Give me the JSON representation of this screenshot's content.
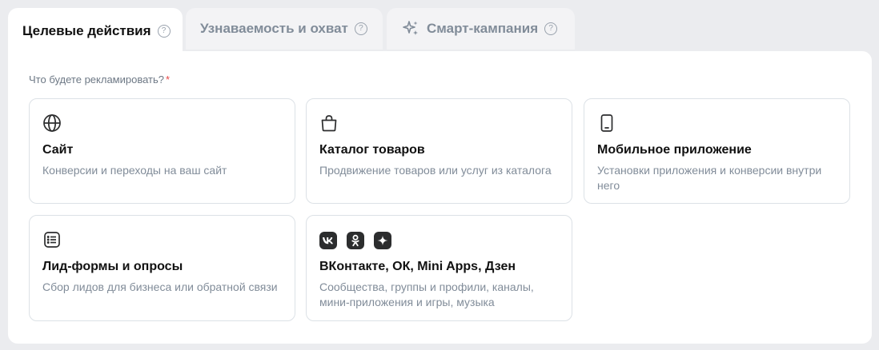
{
  "tabs": [
    {
      "label": "Целевые действия",
      "help": "?"
    },
    {
      "label": "Узнаваемость и охват",
      "help": "?"
    },
    {
      "label": "Смарт-кампания",
      "help": "?"
    }
  ],
  "question": {
    "label": "Что будете рекламировать?",
    "required_mark": "*"
  },
  "cards": [
    {
      "icon": "globe-icon",
      "title": "Сайт",
      "description": "Конверсии и переходы на ваш сайт"
    },
    {
      "icon": "shopping-bag-icon",
      "title": "Каталог товаров",
      "description": "Продвижение товаров или услуг из каталога"
    },
    {
      "icon": "smartphone-icon",
      "title": "Мобильное приложение",
      "description": "Установки приложения и конверсии внутри него"
    },
    {
      "icon": "list-form-icon",
      "title": "Лид-формы и опросы",
      "description": "Сбор лидов для бизнеса или обратной связи"
    },
    {
      "icon": "vk-ok-dzen-icons",
      "title": "ВКонтакте, ОК, Mini Apps, Дзен",
      "description": "Сообщества, группы и профили, каналы, мини-приложения и игры, музыка"
    }
  ],
  "colors": {
    "background": "#ebecef",
    "panel": "#ffffff",
    "inactive_tab": "#f3f3f5",
    "muted_text": "#818c99",
    "required": "#e64646",
    "card_border": "#dce1e6"
  }
}
